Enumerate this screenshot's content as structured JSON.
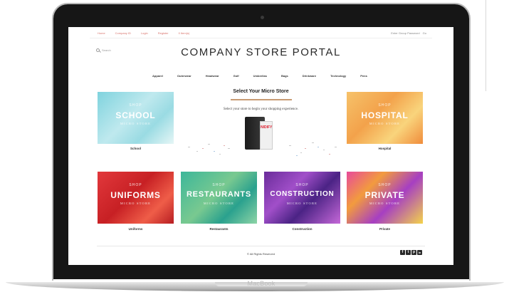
{
  "window": {
    "device_label": "MacBook"
  },
  "topbar": {
    "links": [
      "Home",
      "Company ID",
      "Login",
      "Register",
      "0 Item(s)"
    ],
    "right_text": "Enter Group Password",
    "right_action": "Go"
  },
  "search": {
    "label": "Search"
  },
  "header": {
    "brand": "COMPANY STORE PORTAL"
  },
  "nav": {
    "items": [
      "Apparel",
      "Outerwear",
      "Headwear",
      "Golf",
      "Umbrellas",
      "Bags",
      "Drinkware",
      "Technology",
      "Pens"
    ]
  },
  "main": {
    "title": "Select Your Micro Store",
    "subtitle": "Select your store to begin your shopping experience.",
    "product": {
      "bag_text": "NIDIFY"
    }
  },
  "stores": [
    {
      "shop": "SHOP",
      "name": "SCHOOL",
      "sub": "MICRO STORE",
      "caption": "School"
    },
    {
      "shop": "SHOP",
      "name": "HOSPITAL",
      "sub": "MICRO STORE",
      "caption": "Hospital"
    },
    {
      "shop": "SHOP",
      "name": "UNIFORMS",
      "sub": "MICRO STORE",
      "caption": "Uniforms"
    },
    {
      "shop": "SHOP",
      "name": "RESTAURANTS",
      "sub": "MICRO STORE",
      "caption": "Restaurants"
    },
    {
      "shop": "SHOP",
      "name": "CONSTRUCTION",
      "sub": "MICRO STORE",
      "caption": "Construction"
    },
    {
      "shop": "SHOP",
      "name": "PRIVATE",
      "sub": "MICRO STORE",
      "caption": "Private"
    }
  ],
  "footer": {
    "copyright": "© All Rights Reserved",
    "social": [
      {
        "icon": "facebook-icon",
        "glyph": "f"
      },
      {
        "icon": "twitter-icon",
        "glyph": "t"
      },
      {
        "icon": "pinterest-icon",
        "glyph": "p"
      },
      {
        "icon": "linkedin-icon",
        "glyph": "in"
      }
    ]
  },
  "colors": {
    "link_accent": "#d9746d",
    "rule_accent": "#c89b74",
    "bezel": "#161616"
  }
}
